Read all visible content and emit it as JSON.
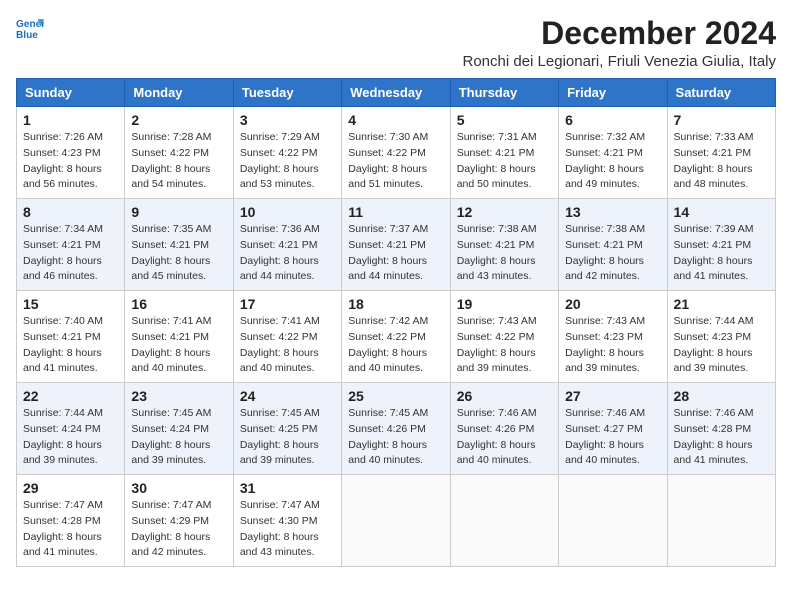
{
  "header": {
    "logo_line1": "General",
    "logo_line2": "Blue",
    "title": "December 2024",
    "subtitle": "Ronchi dei Legionari, Friuli Venezia Giulia, Italy"
  },
  "days_of_week": [
    "Sunday",
    "Monday",
    "Tuesday",
    "Wednesday",
    "Thursday",
    "Friday",
    "Saturday"
  ],
  "weeks": [
    [
      {
        "day": 1,
        "sunrise": "7:26 AM",
        "sunset": "4:23 PM",
        "daylight": "8 hours and 56 minutes."
      },
      {
        "day": 2,
        "sunrise": "7:28 AM",
        "sunset": "4:22 PM",
        "daylight": "8 hours and 54 minutes."
      },
      {
        "day": 3,
        "sunrise": "7:29 AM",
        "sunset": "4:22 PM",
        "daylight": "8 hours and 53 minutes."
      },
      {
        "day": 4,
        "sunrise": "7:30 AM",
        "sunset": "4:22 PM",
        "daylight": "8 hours and 51 minutes."
      },
      {
        "day": 5,
        "sunrise": "7:31 AM",
        "sunset": "4:21 PM",
        "daylight": "8 hours and 50 minutes."
      },
      {
        "day": 6,
        "sunrise": "7:32 AM",
        "sunset": "4:21 PM",
        "daylight": "8 hours and 49 minutes."
      },
      {
        "day": 7,
        "sunrise": "7:33 AM",
        "sunset": "4:21 PM",
        "daylight": "8 hours and 48 minutes."
      }
    ],
    [
      {
        "day": 8,
        "sunrise": "7:34 AM",
        "sunset": "4:21 PM",
        "daylight": "8 hours and 46 minutes."
      },
      {
        "day": 9,
        "sunrise": "7:35 AM",
        "sunset": "4:21 PM",
        "daylight": "8 hours and 45 minutes."
      },
      {
        "day": 10,
        "sunrise": "7:36 AM",
        "sunset": "4:21 PM",
        "daylight": "8 hours and 44 minutes."
      },
      {
        "day": 11,
        "sunrise": "7:37 AM",
        "sunset": "4:21 PM",
        "daylight": "8 hours and 44 minutes."
      },
      {
        "day": 12,
        "sunrise": "7:38 AM",
        "sunset": "4:21 PM",
        "daylight": "8 hours and 43 minutes."
      },
      {
        "day": 13,
        "sunrise": "7:38 AM",
        "sunset": "4:21 PM",
        "daylight": "8 hours and 42 minutes."
      },
      {
        "day": 14,
        "sunrise": "7:39 AM",
        "sunset": "4:21 PM",
        "daylight": "8 hours and 41 minutes."
      }
    ],
    [
      {
        "day": 15,
        "sunrise": "7:40 AM",
        "sunset": "4:21 PM",
        "daylight": "8 hours and 41 minutes."
      },
      {
        "day": 16,
        "sunrise": "7:41 AM",
        "sunset": "4:21 PM",
        "daylight": "8 hours and 40 minutes."
      },
      {
        "day": 17,
        "sunrise": "7:41 AM",
        "sunset": "4:22 PM",
        "daylight": "8 hours and 40 minutes."
      },
      {
        "day": 18,
        "sunrise": "7:42 AM",
        "sunset": "4:22 PM",
        "daylight": "8 hours and 40 minutes."
      },
      {
        "day": 19,
        "sunrise": "7:43 AM",
        "sunset": "4:22 PM",
        "daylight": "8 hours and 39 minutes."
      },
      {
        "day": 20,
        "sunrise": "7:43 AM",
        "sunset": "4:23 PM",
        "daylight": "8 hours and 39 minutes."
      },
      {
        "day": 21,
        "sunrise": "7:44 AM",
        "sunset": "4:23 PM",
        "daylight": "8 hours and 39 minutes."
      }
    ],
    [
      {
        "day": 22,
        "sunrise": "7:44 AM",
        "sunset": "4:24 PM",
        "daylight": "8 hours and 39 minutes."
      },
      {
        "day": 23,
        "sunrise": "7:45 AM",
        "sunset": "4:24 PM",
        "daylight": "8 hours and 39 minutes."
      },
      {
        "day": 24,
        "sunrise": "7:45 AM",
        "sunset": "4:25 PM",
        "daylight": "8 hours and 39 minutes."
      },
      {
        "day": 25,
        "sunrise": "7:45 AM",
        "sunset": "4:26 PM",
        "daylight": "8 hours and 40 minutes."
      },
      {
        "day": 26,
        "sunrise": "7:46 AM",
        "sunset": "4:26 PM",
        "daylight": "8 hours and 40 minutes."
      },
      {
        "day": 27,
        "sunrise": "7:46 AM",
        "sunset": "4:27 PM",
        "daylight": "8 hours and 40 minutes."
      },
      {
        "day": 28,
        "sunrise": "7:46 AM",
        "sunset": "4:28 PM",
        "daylight": "8 hours and 41 minutes."
      }
    ],
    [
      {
        "day": 29,
        "sunrise": "7:47 AM",
        "sunset": "4:28 PM",
        "daylight": "8 hours and 41 minutes."
      },
      {
        "day": 30,
        "sunrise": "7:47 AM",
        "sunset": "4:29 PM",
        "daylight": "8 hours and 42 minutes."
      },
      {
        "day": 31,
        "sunrise": "7:47 AM",
        "sunset": "4:30 PM",
        "daylight": "8 hours and 43 minutes."
      },
      null,
      null,
      null,
      null
    ]
  ],
  "labels": {
    "sunrise_prefix": "Sunrise: ",
    "sunset_prefix": "Sunset: ",
    "daylight_prefix": "Daylight: "
  }
}
